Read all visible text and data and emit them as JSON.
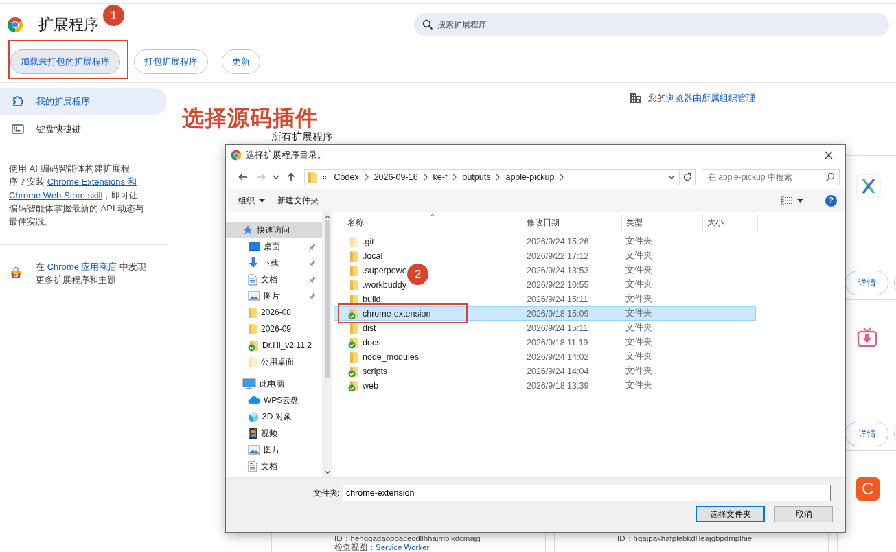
{
  "browser_page": {
    "title": "扩展程序",
    "search": {
      "placeholder": "搜索扩展程序"
    },
    "actions": [
      {
        "label": "加载未打包的扩展程序",
        "highlighted": true
      },
      {
        "label": "打包扩展程序",
        "highlighted": false
      },
      {
        "label": "更新",
        "highlighted": false
      }
    ],
    "sidebar": {
      "items": [
        {
          "label": "我的扩展程序",
          "kind": "puzzle",
          "selected": true
        },
        {
          "label": "键盘快捷键",
          "kind": "keyboard",
          "selected": false
        }
      ],
      "promo": {
        "text_before": "使用 AI 编码智能体构建扩展程序？安装 ",
        "links": [
          "Chrome Extensions 和",
          "Chrome Web Store skill"
        ],
        "text_after": "，即可让编码智能体掌握最新的 API 动态与最佳实践。"
      },
      "store": {
        "text_before": "在 ",
        "link": "Chrome 应用商店",
        "text_after": " 中发现更多扩展程序和主题"
      }
    },
    "managed_notice": {
      "text": "您的",
      "link": "浏览器由所属组织管理"
    },
    "heading": "所有扩展程序",
    "extension_cards": [
      {
        "kind": "x-logo",
        "buttons": [
          "详情"
        ]
      },
      {
        "kind": "tv-download",
        "buttons": [
          "详情"
        ]
      },
      {
        "kind": "text",
        "lines": [
          {
            "label": "ID：hehggadaopoacecdllhhajmbjkdcmajg"
          },
          {
            "label": "检查视图：",
            "link": "Service Worker"
          }
        ]
      },
      {
        "kind": "text",
        "lines": [
          {
            "label": "ID：hgajpakhafplebkdljleajgbpdmplhie"
          }
        ]
      },
      {
        "kind": "letter-logo",
        "logo_text": "C"
      }
    ]
  },
  "dialog": {
    "title": "选择扩展程序目录。",
    "navigation": {
      "back_enabled": true,
      "forward_enabled": false
    },
    "breadcrumb": {
      "overflow": "«",
      "segments": [
        "Codex",
        "2026-09-16",
        "ke-f",
        "outputs",
        "apple-pickup"
      ]
    },
    "search": {
      "placeholder": "在 apple-pickup 中搜索"
    },
    "toolbar": {
      "organize": "组织",
      "new_folder": "新建文件夹",
      "help": "?"
    },
    "nav_tree": [
      {
        "label": "快速访问",
        "kind": "star",
        "selected": true,
        "children": [
          {
            "label": "桌面",
            "kind": "desktop",
            "pinned": true,
            "selected": false
          },
          {
            "label": "下载",
            "kind": "download",
            "pinned": true,
            "selected": false
          },
          {
            "label": "文档",
            "kind": "document",
            "pinned": true,
            "selected": false
          },
          {
            "label": "图片",
            "kind": "picture",
            "pinned": true,
            "selected": false
          },
          {
            "label": "2026-08",
            "kind": "folder",
            "pinned": false,
            "selected": false
          },
          {
            "label": "2026-09",
            "kind": "folder",
            "pinned": false,
            "selected": false
          },
          {
            "label": "Dr.Hi_v2.11.2",
            "kind": "synced-folder",
            "pinned": false,
            "selected": false
          },
          {
            "label": "公用桌面",
            "kind": "faded-folder",
            "pinned": false,
            "selected": false
          }
        ]
      },
      {
        "label": "此电脑",
        "kind": "computer",
        "selected": false,
        "children": [
          {
            "label": "WPS云盘",
            "kind": "cloud",
            "pinned": false,
            "selected": false
          },
          {
            "label": "3D 对象",
            "kind": "cube",
            "pinned": false,
            "selected": false
          },
          {
            "label": "视频",
            "kind": "film",
            "pinned": false,
            "selected": false
          },
          {
            "label": "图片",
            "kind": "picture",
            "pinned": false,
            "selected": false
          },
          {
            "label": "文档",
            "kind": "document",
            "pinned": false,
            "selected": false
          }
        ]
      }
    ],
    "columns": [
      "名称",
      "修改日期",
      "类型",
      "大小"
    ],
    "files": [
      {
        "name": ".git",
        "modified": "2026/9/24 15:26",
        "type": "文件夹",
        "kind": "faded-folder",
        "synced": false,
        "selected": false
      },
      {
        "name": ".local",
        "modified": "2026/9/22 17:12",
        "type": "文件夹",
        "kind": "folder",
        "synced": false,
        "selected": false
      },
      {
        "name": ".superpowe",
        "modified": "2026/9/24 13:53",
        "type": "文件夹",
        "kind": "folder",
        "synced": false,
        "selected": false
      },
      {
        "name": ".workbuddy",
        "modified": "2026/9/22 10:55",
        "type": "文件夹",
        "kind": "folder",
        "synced": false,
        "selected": false
      },
      {
        "name": "build",
        "modified": "2026/9/24 15:11",
        "type": "文件夹",
        "kind": "folder",
        "synced": false,
        "selected": false
      },
      {
        "name": "chrome-extension",
        "modified": "2026/9/18 15:09",
        "type": "文件夹",
        "kind": "folder",
        "synced": true,
        "selected": true
      },
      {
        "name": "dist",
        "modified": "2026/9/24 15:11",
        "type": "文件夹",
        "kind": "folder",
        "synced": false,
        "selected": false
      },
      {
        "name": "docs",
        "modified": "2026/9/18 11:19",
        "type": "文件夹",
        "kind": "folder",
        "synced": true,
        "selected": false
      },
      {
        "name": "node_modules",
        "modified": "2026/9/24 14:02",
        "type": "文件夹",
        "kind": "folder",
        "synced": false,
        "selected": false
      },
      {
        "name": "scripts",
        "modified": "2026/9/24 14:04",
        "type": "文件夹",
        "kind": "folder",
        "synced": true,
        "selected": false
      },
      {
        "name": "web",
        "modified": "2026/9/18 13:39",
        "type": "文件夹",
        "kind": "folder",
        "synced": true,
        "selected": false
      }
    ],
    "folder_field": {
      "label": "文件夹:",
      "value": "chrome-extension"
    },
    "buttons": [
      {
        "label": "选择文件夹",
        "default": true
      },
      {
        "label": "取消",
        "default": false
      }
    ]
  },
  "annotations": {
    "caption": "选择源码插件",
    "badges": [
      "1",
      "2"
    ]
  }
}
